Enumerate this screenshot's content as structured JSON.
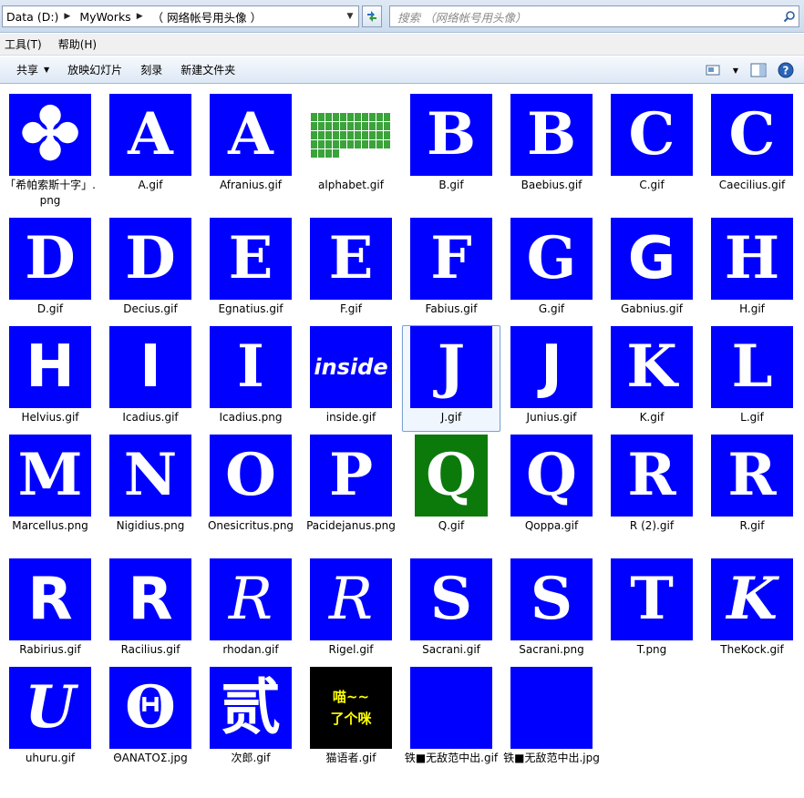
{
  "address": {
    "crumbs": [
      "Data (D:)",
      "MyWorks",
      "（ 网络帐号用头像 ）"
    ]
  },
  "search": {
    "placeholder": "搜索 （网络帐号用头像）"
  },
  "menu": {
    "items": [
      "工具(T)",
      "帮助(H)"
    ]
  },
  "toolbar": {
    "share_label": "共享",
    "slideshow_label": "放映幻灯片",
    "burn_label": "刻录",
    "new_folder_label": "新建文件夹"
  },
  "colors": {
    "thumb_blue": "#0000ff",
    "thumb_green": "#0b7a0b",
    "selection_border": "#7da2ce"
  },
  "files": [
    {
      "name": "「希帕索斯十字」.png",
      "glyph": "✤",
      "kind": "blue"
    },
    {
      "name": "A.gif",
      "glyph": "A",
      "kind": "blue"
    },
    {
      "name": "Afranius.gif",
      "glyph": "A",
      "kind": "blue"
    },
    {
      "name": "alphabet.gif",
      "glyph": "",
      "kind": "tile"
    },
    {
      "name": "B.gif",
      "glyph": "B",
      "kind": "blue"
    },
    {
      "name": "Baebius.gif",
      "glyph": "B",
      "kind": "blue"
    },
    {
      "name": "C.gif",
      "glyph": "C",
      "kind": "blue"
    },
    {
      "name": "Caecilius.gif",
      "glyph": "C",
      "kind": "blue"
    },
    {
      "name": "D.gif",
      "glyph": "D",
      "kind": "blue"
    },
    {
      "name": "Decius.gif",
      "glyph": "D",
      "kind": "blue"
    },
    {
      "name": "Egnatius.gif",
      "glyph": "E",
      "kind": "blue"
    },
    {
      "name": "F.gif",
      "glyph": "E",
      "kind": "blue"
    },
    {
      "name": "Fabius.gif",
      "glyph": "F",
      "kind": "blue"
    },
    {
      "name": "G.gif",
      "glyph": "G",
      "kind": "blue"
    },
    {
      "name": "Gabnius.gif",
      "glyph": "G",
      "kind": "blue"
    },
    {
      "name": "H.gif",
      "glyph": "H",
      "kind": "blue"
    },
    {
      "name": "Helvius.gif",
      "glyph": "H",
      "kind": "blue"
    },
    {
      "name": "Icadius.gif",
      "glyph": "I",
      "kind": "blue"
    },
    {
      "name": "Icadius.png",
      "glyph": "I",
      "kind": "blue"
    },
    {
      "name": "inside.gif",
      "glyph": "inside",
      "kind": "blue"
    },
    {
      "name": "J.gif",
      "glyph": "J",
      "kind": "blue",
      "selected": true
    },
    {
      "name": "Junius.gif",
      "glyph": "J",
      "kind": "blue"
    },
    {
      "name": "K.gif",
      "glyph": "K",
      "kind": "blue"
    },
    {
      "name": "L.gif",
      "glyph": "L",
      "kind": "blue"
    },
    {
      "name": "Marcellus.png",
      "glyph": "M",
      "kind": "blue"
    },
    {
      "name": "Nigidius.png",
      "glyph": "N",
      "kind": "blue"
    },
    {
      "name": "Onesicritus.png",
      "glyph": "O",
      "kind": "blue"
    },
    {
      "name": "Pacidejanus.png",
      "glyph": "P",
      "kind": "blue"
    },
    {
      "name": "Q.gif",
      "glyph": "Q",
      "kind": "green"
    },
    {
      "name": "Qoppa.gif",
      "glyph": "Q",
      "kind": "blue"
    },
    {
      "name": "R (2).gif",
      "glyph": "R",
      "kind": "blue"
    },
    {
      "name": "R.gif",
      "glyph": "R",
      "kind": "blue"
    },
    {
      "name": "Rabirius.gif",
      "glyph": "R",
      "kind": "blue"
    },
    {
      "name": "Racilius.gif",
      "glyph": "R",
      "kind": "blue"
    },
    {
      "name": "rhodan.gif",
      "glyph": "R",
      "kind": "blue"
    },
    {
      "name": "Rigel.gif",
      "glyph": "R",
      "kind": "blue"
    },
    {
      "name": "Sacrani.gif",
      "glyph": "S",
      "kind": "blue"
    },
    {
      "name": "Sacrani.png",
      "glyph": "S",
      "kind": "blue"
    },
    {
      "name": "T.png",
      "glyph": "T",
      "kind": "blue"
    },
    {
      "name": "TheKock.gif",
      "glyph": "K",
      "kind": "blue"
    },
    {
      "name": "uhuru.gif",
      "glyph": "U",
      "kind": "blue"
    },
    {
      "name": "ΘΑΝΑΤΟΣ.jpg",
      "glyph": "Θ",
      "kind": "blue"
    },
    {
      "name": "次郎.gif",
      "glyph": "贰",
      "kind": "blue"
    },
    {
      "name": "猫语者.gif",
      "glyph": "喵~~ 了个咪",
      "kind": "black"
    },
    {
      "name": "铁■无敌范中出.gif",
      "glyph": "",
      "kind": "plain"
    },
    {
      "name": "铁■无敌范中出.jpg",
      "glyph": "",
      "kind": "plain"
    }
  ]
}
